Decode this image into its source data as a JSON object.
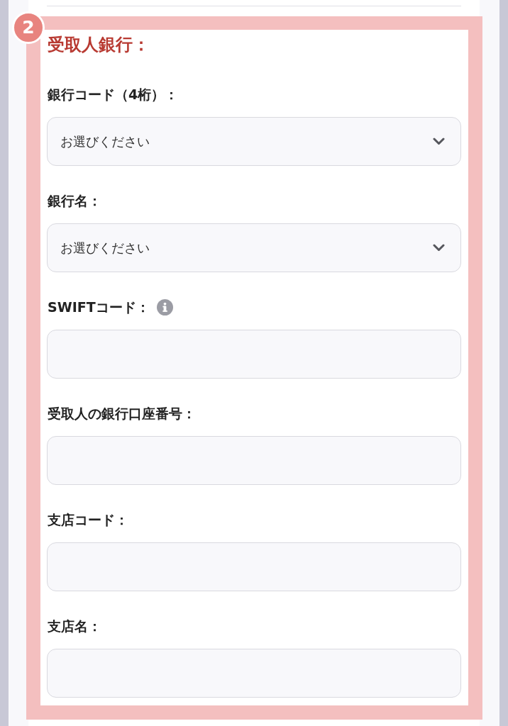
{
  "step_badge": {
    "number": "2"
  },
  "section": {
    "title": "受取人銀行："
  },
  "fields": [
    {
      "kind": "select",
      "label": "銀行コード（4桁）：",
      "value": "お選びください",
      "info": false
    },
    {
      "kind": "select",
      "label": "銀行名：",
      "value": "お選びください",
      "info": false
    },
    {
      "kind": "text",
      "label": "SWIFTコード：",
      "info": true
    },
    {
      "kind": "text",
      "label": "受取人の銀行口座番号：",
      "info": false
    },
    {
      "kind": "text",
      "label": "支店コード：",
      "info": false
    },
    {
      "kind": "text",
      "label": "支店名：",
      "info": false
    }
  ]
}
